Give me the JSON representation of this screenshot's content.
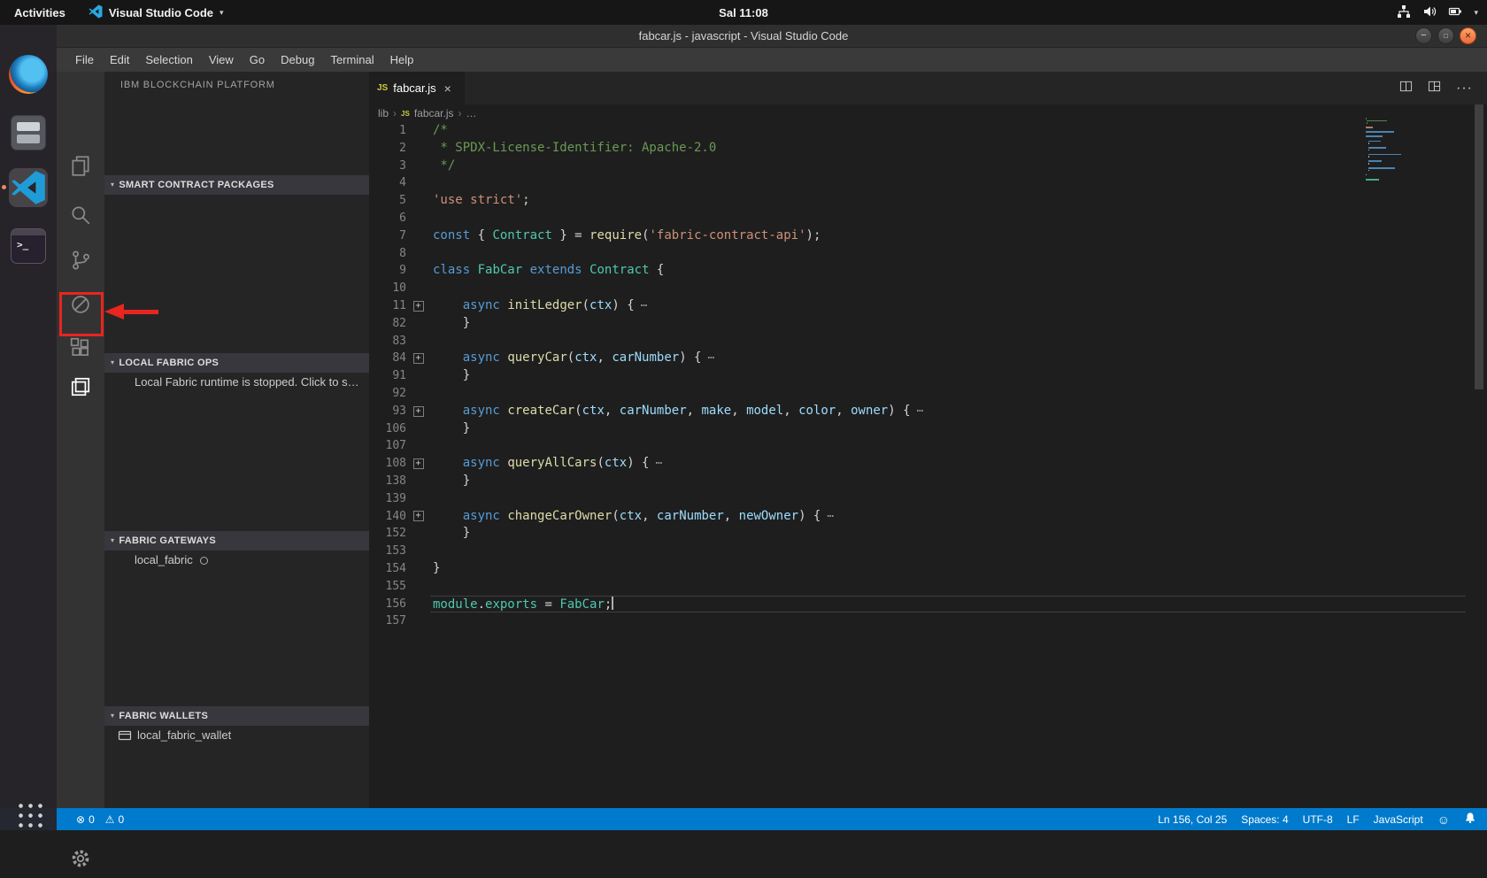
{
  "colors": {
    "accent": "#007ACC",
    "statusbar_bg": "#007ACC",
    "editor_bg": "#1E1E1E",
    "sidebar_bg": "#252526",
    "activitybar_bg": "#333333",
    "annotation_red": "#E8251F",
    "close_button_orange": "#EE6A3A",
    "js_icon_yellow": "#CBCB41"
  },
  "gnome_bar": {
    "activities_label": "Activities",
    "app_name": "Visual Studio Code",
    "clock": "Sal 11:08",
    "tray_icons": [
      "network-icon",
      "volume-icon",
      "battery-icon",
      "caret-down-icon"
    ]
  },
  "titlebar": {
    "title": "fabcar.js - javascript - Visual Studio Code",
    "minimize_glyph": "−",
    "maximize_glyph": "□",
    "close_glyph": "×"
  },
  "menubar": {
    "items": [
      "File",
      "Edit",
      "Selection",
      "View",
      "Go",
      "Debug",
      "Terminal",
      "Help"
    ]
  },
  "dock": {
    "items": [
      "firefox",
      "files",
      "vscode",
      "terminal"
    ],
    "active_item": "vscode"
  },
  "activity_bar": {
    "icons": [
      "explorer",
      "search",
      "source-control",
      "debug",
      "extensions",
      "ibm-blockchain-platform"
    ],
    "active": "ibm-blockchain-platform",
    "bottom_icons": [
      "settings-gear"
    ]
  },
  "annotation": {
    "type": "red box with arrow",
    "target": "ibm-blockchain-platform-icon",
    "color": "#E8251F"
  },
  "sidebar": {
    "title": "IBM BLOCKCHAIN PLATFORM",
    "sections": [
      {
        "label": "SMART CONTRACT PACKAGES",
        "expanded": true,
        "items": []
      },
      {
        "label": "LOCAL FABRIC OPS",
        "expanded": true,
        "items": [
          {
            "label": "Local Fabric runtime is stopped. Click to s…"
          }
        ]
      },
      {
        "label": "FABRIC GATEWAYS",
        "expanded": true,
        "items": [
          {
            "label": "local_fabric",
            "status_icon": "circle-outline"
          }
        ]
      },
      {
        "label": "FABRIC WALLETS",
        "expanded": true,
        "items": [
          {
            "label": "local_fabric_wallet",
            "icon": "wallet-icon"
          }
        ]
      }
    ]
  },
  "editor": {
    "tab": {
      "label": "fabcar.js",
      "type_badge": "JS",
      "close_glyph": "×"
    },
    "actions": [
      "split-editor",
      "editor-layout",
      "more-actions"
    ],
    "more_glyph": "···",
    "breadcrumb": {
      "folder": "lib",
      "file": "fabcar.js",
      "symbol": "…",
      "separator": "›"
    },
    "fold_glyph": "+",
    "folded_badge": "⋯",
    "token_colors": {
      "comment": "#6A9955",
      "string": "#CE9178",
      "kw": "#569CD6",
      "type": "#4EC9B0",
      "fn": "#DCDCAA",
      "var": "#9CDCFE",
      "def": "#D4D4D4"
    },
    "lines": [
      {
        "n": 1,
        "tokens": [
          [
            "comment",
            "/*"
          ]
        ]
      },
      {
        "n": 2,
        "tokens": [
          [
            "comment",
            " * SPDX-License-Identifier: Apache-2.0"
          ]
        ]
      },
      {
        "n": 3,
        "tokens": [
          [
            "comment",
            " */"
          ]
        ]
      },
      {
        "n": 4,
        "tokens": []
      },
      {
        "n": 5,
        "tokens": [
          [
            "string",
            "'use strict'"
          ],
          [
            "def",
            ";"
          ]
        ]
      },
      {
        "n": 6,
        "tokens": []
      },
      {
        "n": 7,
        "tokens": [
          [
            "kw",
            "const"
          ],
          [
            "def",
            " { "
          ],
          [
            "type",
            "Contract"
          ],
          [
            "def",
            " } = "
          ],
          [
            "fn",
            "require"
          ],
          [
            "def",
            "("
          ],
          [
            "string",
            "'fabric-contract-api'"
          ],
          [
            "def",
            ");"
          ]
        ]
      },
      {
        "n": 8,
        "tokens": []
      },
      {
        "n": 9,
        "tokens": [
          [
            "kw",
            "class"
          ],
          [
            "def",
            " "
          ],
          [
            "type",
            "FabCar"
          ],
          [
            "def",
            " "
          ],
          [
            "kw",
            "extends"
          ],
          [
            "def",
            " "
          ],
          [
            "type",
            "Contract"
          ],
          [
            "def",
            " {"
          ]
        ]
      },
      {
        "n": 10,
        "tokens": []
      },
      {
        "n": 11,
        "fold": true,
        "folded": true,
        "tokens": [
          [
            "def",
            "    "
          ],
          [
            "kw",
            "async"
          ],
          [
            "def",
            " "
          ],
          [
            "fn",
            "initLedger"
          ],
          [
            "def",
            "("
          ],
          [
            "var",
            "ctx"
          ],
          [
            "def",
            ") {"
          ]
        ]
      },
      {
        "n": 82,
        "tokens": [
          [
            "def",
            "    }"
          ]
        ]
      },
      {
        "n": 83,
        "tokens": []
      },
      {
        "n": 84,
        "fold": true,
        "folded": true,
        "tokens": [
          [
            "def",
            "    "
          ],
          [
            "kw",
            "async"
          ],
          [
            "def",
            " "
          ],
          [
            "fn",
            "queryCar"
          ],
          [
            "def",
            "("
          ],
          [
            "var",
            "ctx"
          ],
          [
            "def",
            ", "
          ],
          [
            "var",
            "carNumber"
          ],
          [
            "def",
            ") {"
          ]
        ]
      },
      {
        "n": 91,
        "tokens": [
          [
            "def",
            "    }"
          ]
        ]
      },
      {
        "n": 92,
        "tokens": []
      },
      {
        "n": 93,
        "fold": true,
        "folded": true,
        "tokens": [
          [
            "def",
            "    "
          ],
          [
            "kw",
            "async"
          ],
          [
            "def",
            " "
          ],
          [
            "fn",
            "createCar"
          ],
          [
            "def",
            "("
          ],
          [
            "var",
            "ctx"
          ],
          [
            "def",
            ", "
          ],
          [
            "var",
            "carNumber"
          ],
          [
            "def",
            ", "
          ],
          [
            "var",
            "make"
          ],
          [
            "def",
            ", "
          ],
          [
            "var",
            "model"
          ],
          [
            "def",
            ", "
          ],
          [
            "var",
            "color"
          ],
          [
            "def",
            ", "
          ],
          [
            "var",
            "owner"
          ],
          [
            "def",
            ") {"
          ]
        ]
      },
      {
        "n": 106,
        "tokens": [
          [
            "def",
            "    }"
          ]
        ]
      },
      {
        "n": 107,
        "tokens": []
      },
      {
        "n": 108,
        "fold": true,
        "folded": true,
        "tokens": [
          [
            "def",
            "    "
          ],
          [
            "kw",
            "async"
          ],
          [
            "def",
            " "
          ],
          [
            "fn",
            "queryAllCars"
          ],
          [
            "def",
            "("
          ],
          [
            "var",
            "ctx"
          ],
          [
            "def",
            ") {"
          ]
        ]
      },
      {
        "n": 138,
        "tokens": [
          [
            "def",
            "    }"
          ]
        ]
      },
      {
        "n": 139,
        "tokens": []
      },
      {
        "n": 140,
        "fold": true,
        "folded": true,
        "tokens": [
          [
            "def",
            "    "
          ],
          [
            "kw",
            "async"
          ],
          [
            "def",
            " "
          ],
          [
            "fn",
            "changeCarOwner"
          ],
          [
            "def",
            "("
          ],
          [
            "var",
            "ctx"
          ],
          [
            "def",
            ", "
          ],
          [
            "var",
            "carNumber"
          ],
          [
            "def",
            ", "
          ],
          [
            "var",
            "newOwner"
          ],
          [
            "def",
            ") {"
          ]
        ]
      },
      {
        "n": 152,
        "tokens": [
          [
            "def",
            "    }"
          ]
        ]
      },
      {
        "n": 153,
        "tokens": []
      },
      {
        "n": 154,
        "tokens": [
          [
            "def",
            "}"
          ]
        ]
      },
      {
        "n": 155,
        "tokens": []
      },
      {
        "n": 156,
        "current": true,
        "cursor": true,
        "tokens": [
          [
            "type",
            "module"
          ],
          [
            "def",
            "."
          ],
          [
            "type",
            "exports"
          ],
          [
            "def",
            " = "
          ],
          [
            "type",
            "FabCar"
          ],
          [
            "def",
            ";"
          ]
        ]
      },
      {
        "n": 157,
        "tokens": []
      }
    ]
  },
  "status_bar": {
    "errors": "0",
    "warnings": "0",
    "cursor_position": "Ln 156, Col 25",
    "indentation": "Spaces: 4",
    "encoding": "UTF-8",
    "eol": "LF",
    "language": "JavaScript",
    "right_icons": [
      "feedback-smiley-icon",
      "bell-icon"
    ]
  }
}
